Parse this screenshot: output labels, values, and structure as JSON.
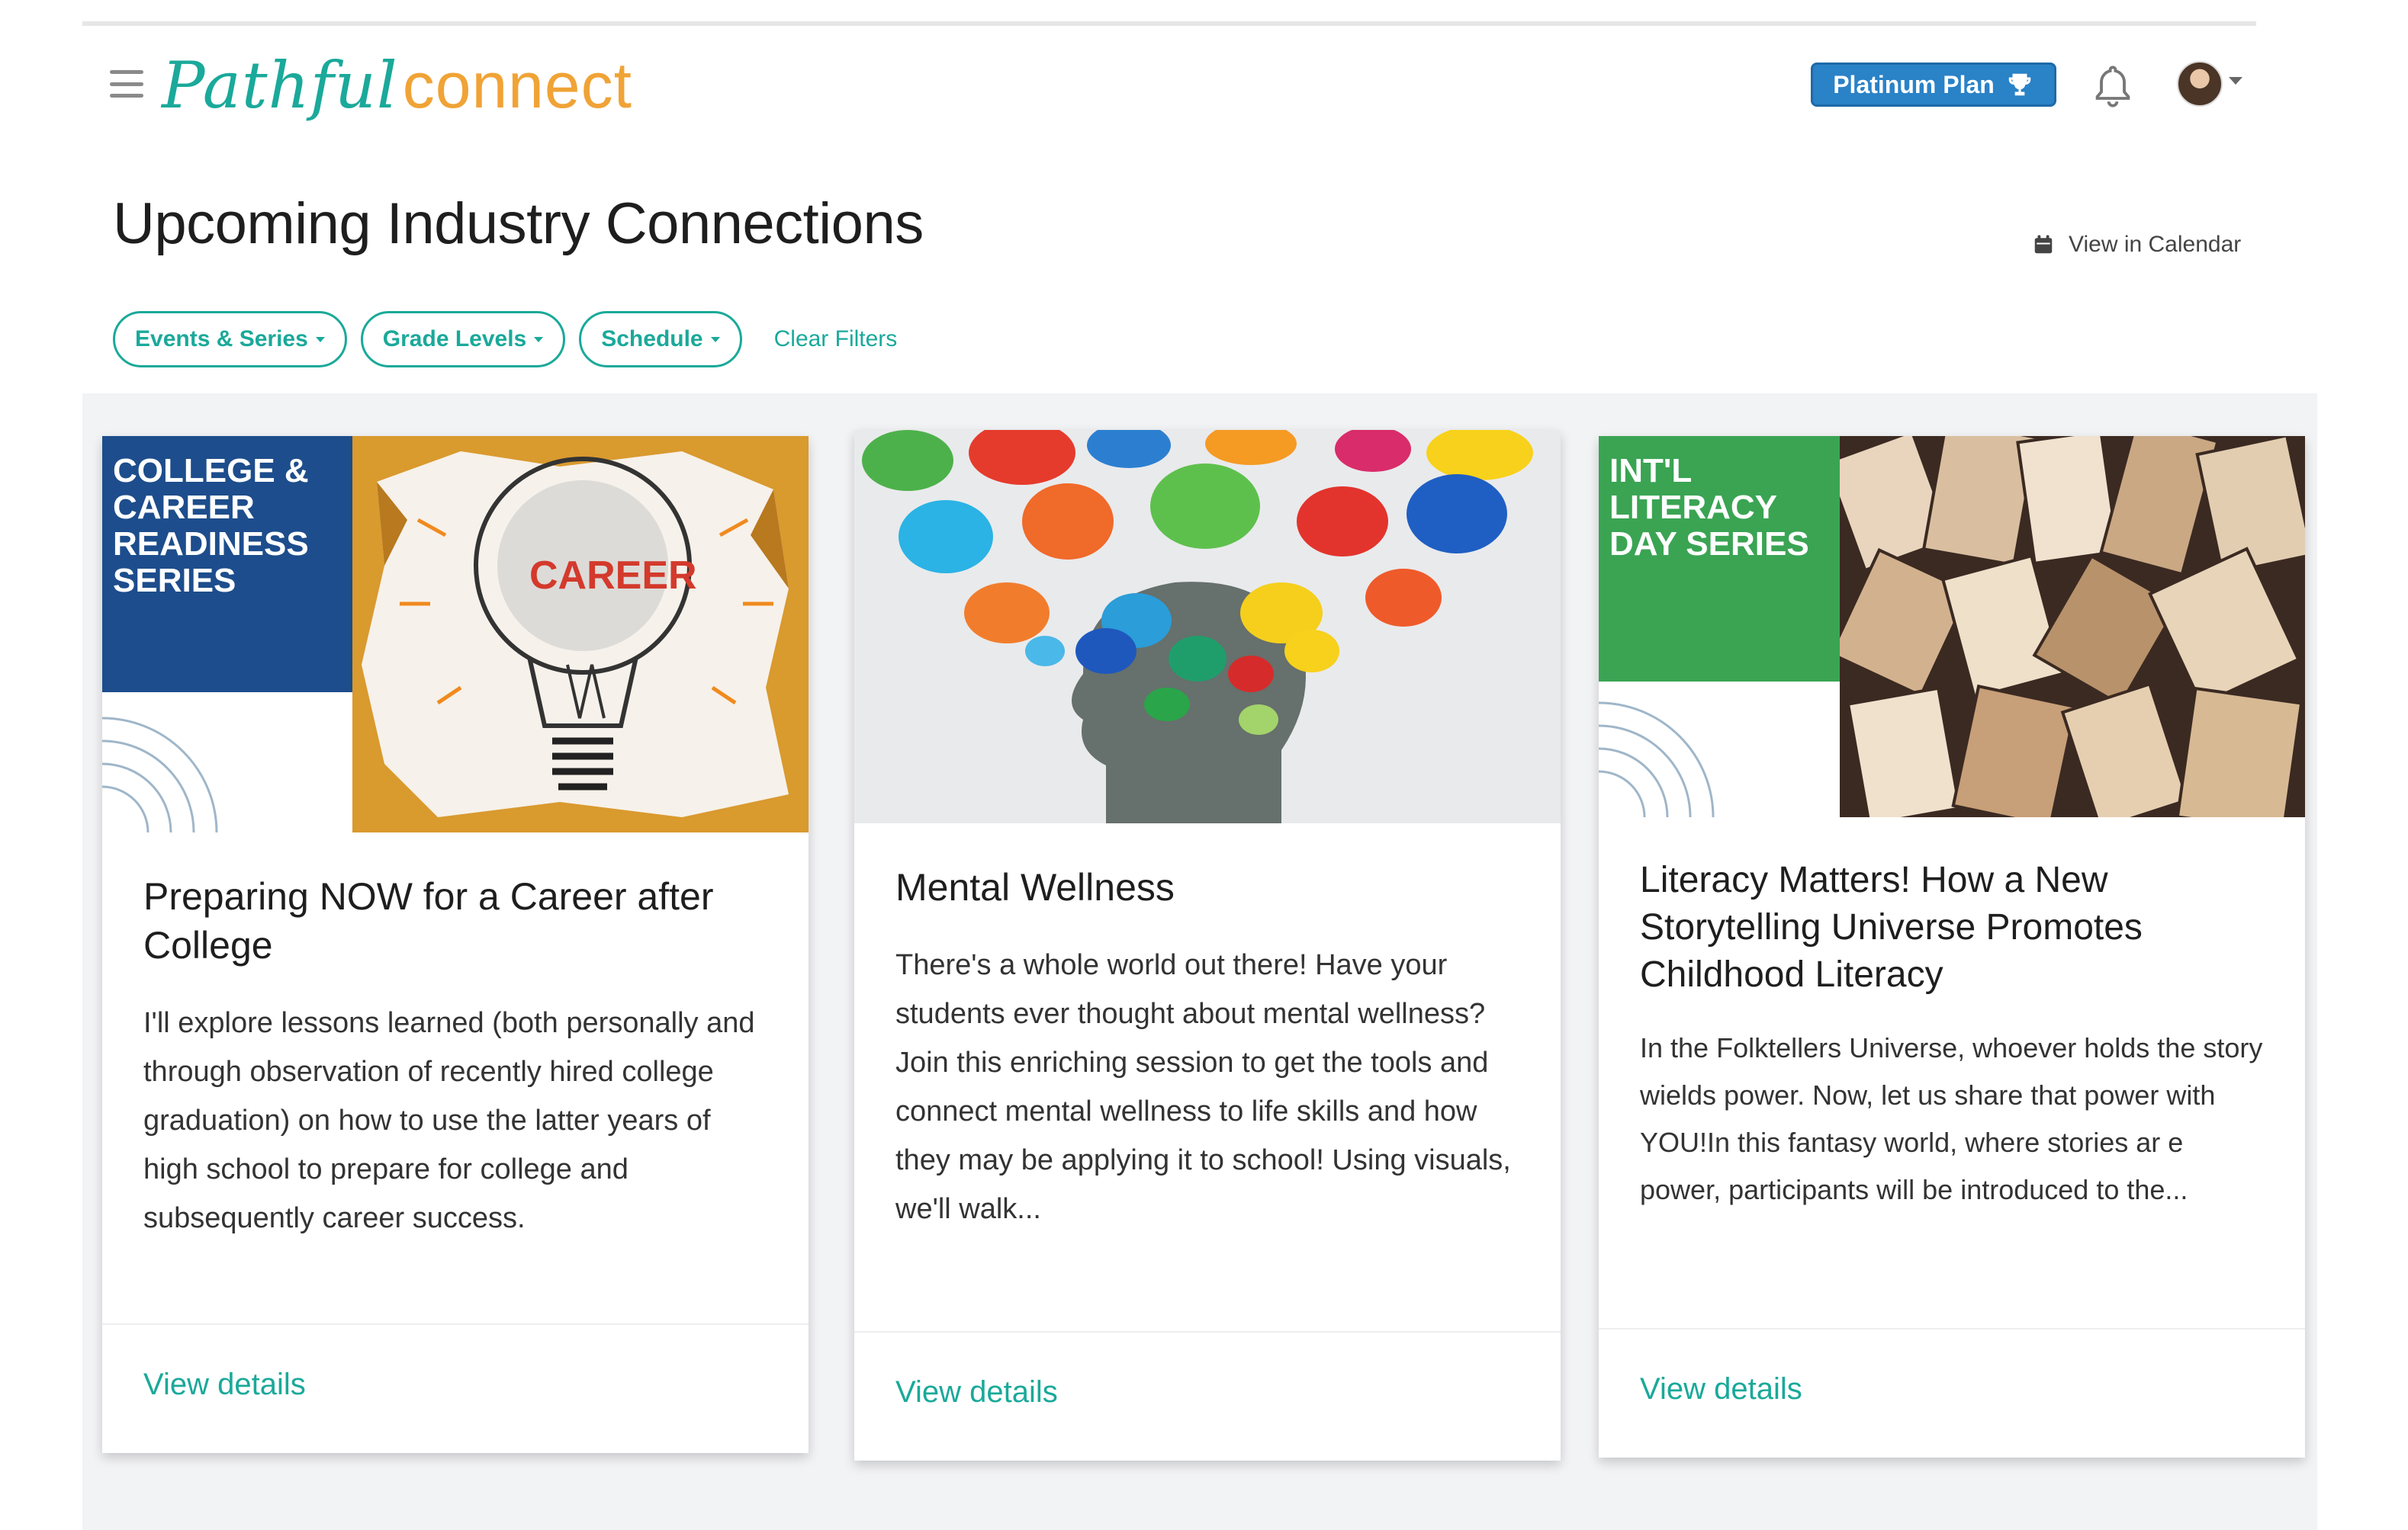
{
  "app": {
    "logo_part1": "Pathful",
    "logo_part2": "connect",
    "plan_badge": "Platinum Plan",
    "brand_color": "#1aa99a",
    "accent_orange": "#f0a336",
    "plan_color": "#2a82c7"
  },
  "header": {
    "title": "Upcoming Industry Connections",
    "view_calendar": "View in Calendar"
  },
  "filters": {
    "items": [
      {
        "label": "Events & Series"
      },
      {
        "label": "Grade Levels"
      },
      {
        "label": "Schedule"
      }
    ],
    "clear_label": "Clear Filters"
  },
  "cards": [
    {
      "series_label": "COLLEGE & CAREER READINESS SERIES",
      "series_color": "#1d4d8c",
      "image_word": "CAREER",
      "title": "Preparing NOW for a Career after College",
      "description": "I'll explore lessons learned (both personally and through observation of recently hired college graduation) on how to use the latter years of high school to prepare for college and subsequently career success.",
      "link": "View details"
    },
    {
      "series_label": "",
      "title": "Mental Wellness",
      "description": "There's a whole world out there! Have your students ever thought about mental wellness? Join this enriching session to get the tools and connect mental wellness to life skills and how they may be applying it to school! Using visuals, we'll walk...",
      "link": "View details"
    },
    {
      "series_label": "INT'L LITERACY DAY SERIES",
      "series_color": "#3aa453",
      "title": "Literacy Matters! How a New Storytelling Universe Promotes Childhood Literacy",
      "description": "In the Folktellers Universe, whoever holds the story wields power. Now, let us share that power with YOU!In this fantasy world, where stories ar e power, participants will be introduced to the...",
      "link": "View details"
    }
  ]
}
